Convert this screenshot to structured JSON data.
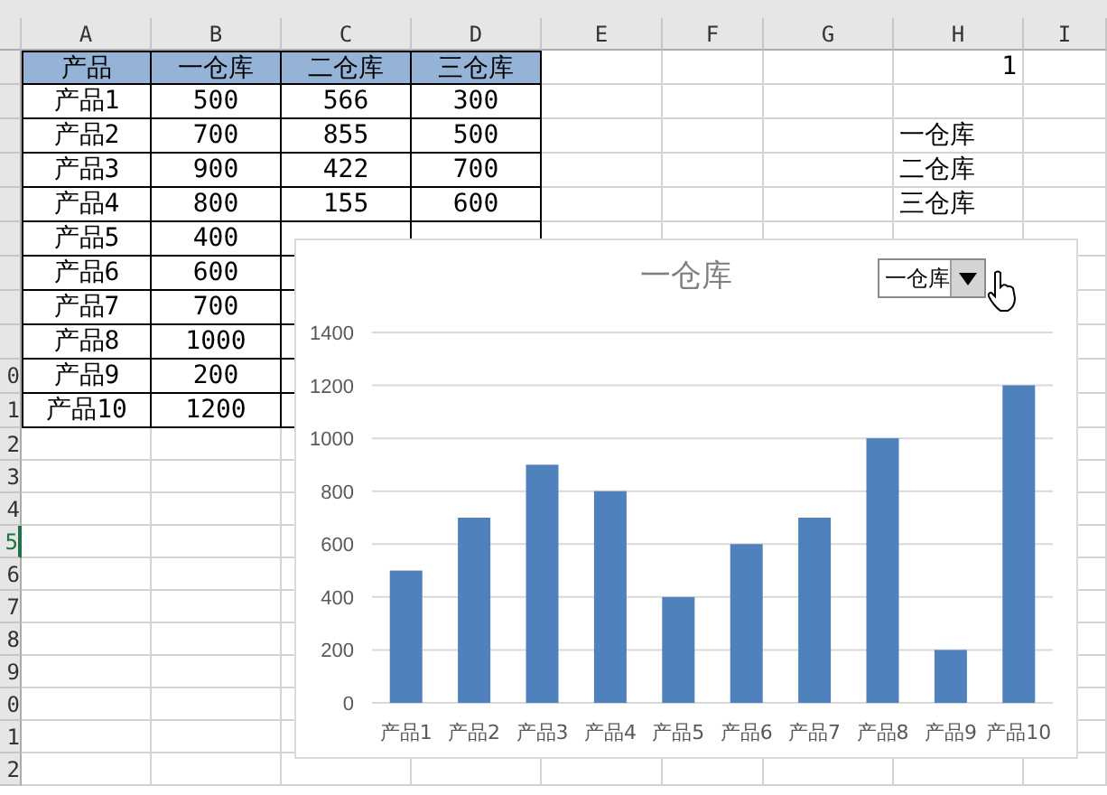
{
  "column_headers": [
    "A",
    "B",
    "C",
    "D",
    "E",
    "F",
    "G",
    "H",
    "I"
  ],
  "row_headers": [
    {
      "selected": false
    },
    {
      "selected": false
    },
    {
      "selected": false
    },
    {
      "selected": false
    },
    {
      "selected": false
    },
    {
      "selected": false
    },
    {
      "selected": false
    },
    {
      "selected": false
    },
    {
      "selected": false
    },
    {
      "label": "0",
      "selected": false
    },
    {
      "label": "1",
      "selected": false
    },
    {
      "label": "2",
      "selected": false
    },
    {
      "label": "3",
      "selected": false
    },
    {
      "label": "4",
      "selected": false
    },
    {
      "label": "5",
      "selected": true
    },
    {
      "label": "6",
      "selected": false
    },
    {
      "label": "7",
      "selected": false
    },
    {
      "label": "8",
      "selected": false
    },
    {
      "label": "9",
      "selected": false
    },
    {
      "label": "0",
      "selected": false
    },
    {
      "label": "1",
      "selected": false
    },
    {
      "label": "2",
      "selected": false
    }
  ],
  "table": {
    "header": [
      "产品",
      "一仓库",
      "二仓库",
      "三仓库"
    ],
    "rows": [
      [
        "产品1",
        "500",
        "566",
        "300"
      ],
      [
        "产品2",
        "700",
        "855",
        "500"
      ],
      [
        "产品3",
        "900",
        "422",
        "700"
      ],
      [
        "产品4",
        "800",
        "155",
        "600"
      ],
      [
        "产品5",
        "400"
      ],
      [
        "产品6",
        "600"
      ],
      [
        "产品7",
        "700"
      ],
      [
        "产品8",
        "1000"
      ],
      [
        "产品9",
        "200"
      ],
      [
        "产品10",
        "1200"
      ]
    ]
  },
  "column_h": {
    "top_value": "1",
    "items": [
      "一仓库",
      "二仓库",
      "三仓库"
    ]
  },
  "chart": {
    "dropdown": {
      "value": "一仓库"
    },
    "chart_data": {
      "type": "bar",
      "title": "一仓库",
      "categories": [
        "产品1",
        "产品2",
        "产品3",
        "产品4",
        "产品5",
        "产品6",
        "产品7",
        "产品8",
        "产品9",
        "产品10"
      ],
      "grid": true,
      "series": [
        {
          "color": "#4f81bd",
          "values": [
            500,
            700,
            900,
            800,
            400,
            600,
            700,
            1000,
            200,
            1200
          ]
        }
      ],
      "ylim": [
        0,
        1400
      ],
      "yticks": [
        0,
        200,
        400,
        600,
        800,
        1000,
        1200,
        1400
      ]
    }
  }
}
